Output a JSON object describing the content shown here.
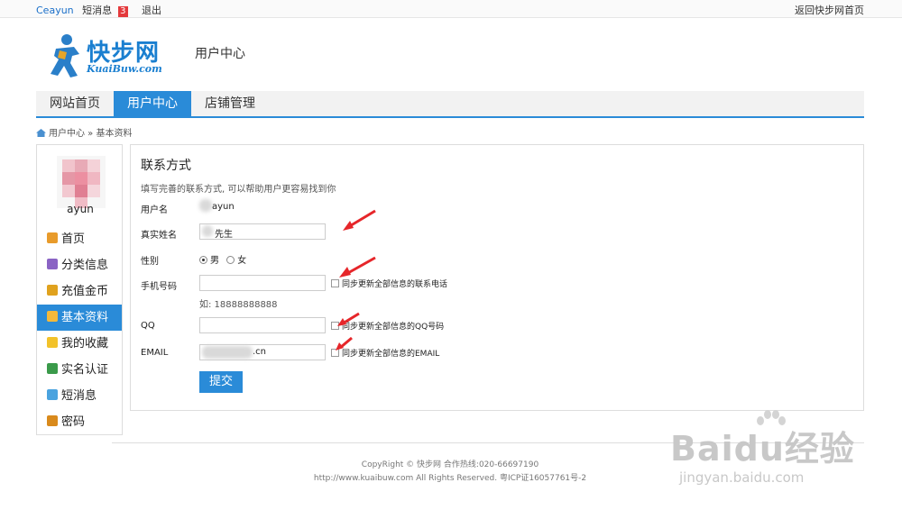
{
  "topbar": {
    "username": "Ceayun",
    "messages_label": "短消息",
    "messages_count": "3",
    "logout": "退出",
    "home_link": "返回快步网首页"
  },
  "brand": {
    "logo_text": "快步网",
    "logo_sub": "KuaiBuw.com",
    "section_title": "用户中心"
  },
  "nav": {
    "items": [
      {
        "label": "网站首页",
        "active": false
      },
      {
        "label": "用户中心",
        "active": true
      },
      {
        "label": "店铺管理",
        "active": false
      }
    ]
  },
  "breadcrumb": {
    "text": "用户中心 » 基本资料"
  },
  "sidebar": {
    "avatar_name": "ayun",
    "items": [
      {
        "label": "首页",
        "icon": "home-icon",
        "color": "#e89b2b"
      },
      {
        "label": "分类信息",
        "icon": "edit-icon",
        "color": "#8a63c4"
      },
      {
        "label": "充值金币",
        "icon": "coins-icon",
        "color": "#e0a21e"
      },
      {
        "label": "基本资料",
        "icon": "profile-icon",
        "color": "#f3b93a"
      },
      {
        "label": "我的收藏",
        "icon": "star-icon",
        "color": "#f2c22a"
      },
      {
        "label": "实名认证",
        "icon": "id-card-icon",
        "color": "#3a9a4a"
      },
      {
        "label": "短消息",
        "icon": "chat-icon",
        "color": "#4aa3df"
      },
      {
        "label": "密码",
        "icon": "lock-icon",
        "color": "#d98a1c"
      }
    ],
    "active_index": 3
  },
  "form": {
    "title": "联系方式",
    "description": "填写完善的联系方式, 可以帮助用户更容易找到你",
    "username_label": "用户名",
    "username_value": "ayun",
    "realname_label": "真实姓名",
    "realname_value": "先生",
    "gender_label": "性别",
    "gender_male": "男",
    "gender_female": "女",
    "phone_label": "手机号码",
    "phone_value": "",
    "phone_sync": "同步更新全部信息的联系电话",
    "phone_hint": "如: 18888888888",
    "qq_label": "QQ",
    "qq_value": "",
    "qq_sync": "同步更新全部信息的QQ号码",
    "email_label": "EMAIL",
    "email_value": ".cn",
    "email_sync": "同步更新全部信息的EMAIL",
    "submit": "提交"
  },
  "footer": {
    "line1": "CopyRight © 快步网 合作热线:020-66697190",
    "line2": "http://www.kuaibuw.com All Rights Reserved. 粤ICP证16057761号-2"
  },
  "watermark": {
    "big": "Baidu经验",
    "small": "jingyan.baidu.com"
  },
  "colors": {
    "accent": "#2a8bd8",
    "annotation": "#e6262a"
  }
}
